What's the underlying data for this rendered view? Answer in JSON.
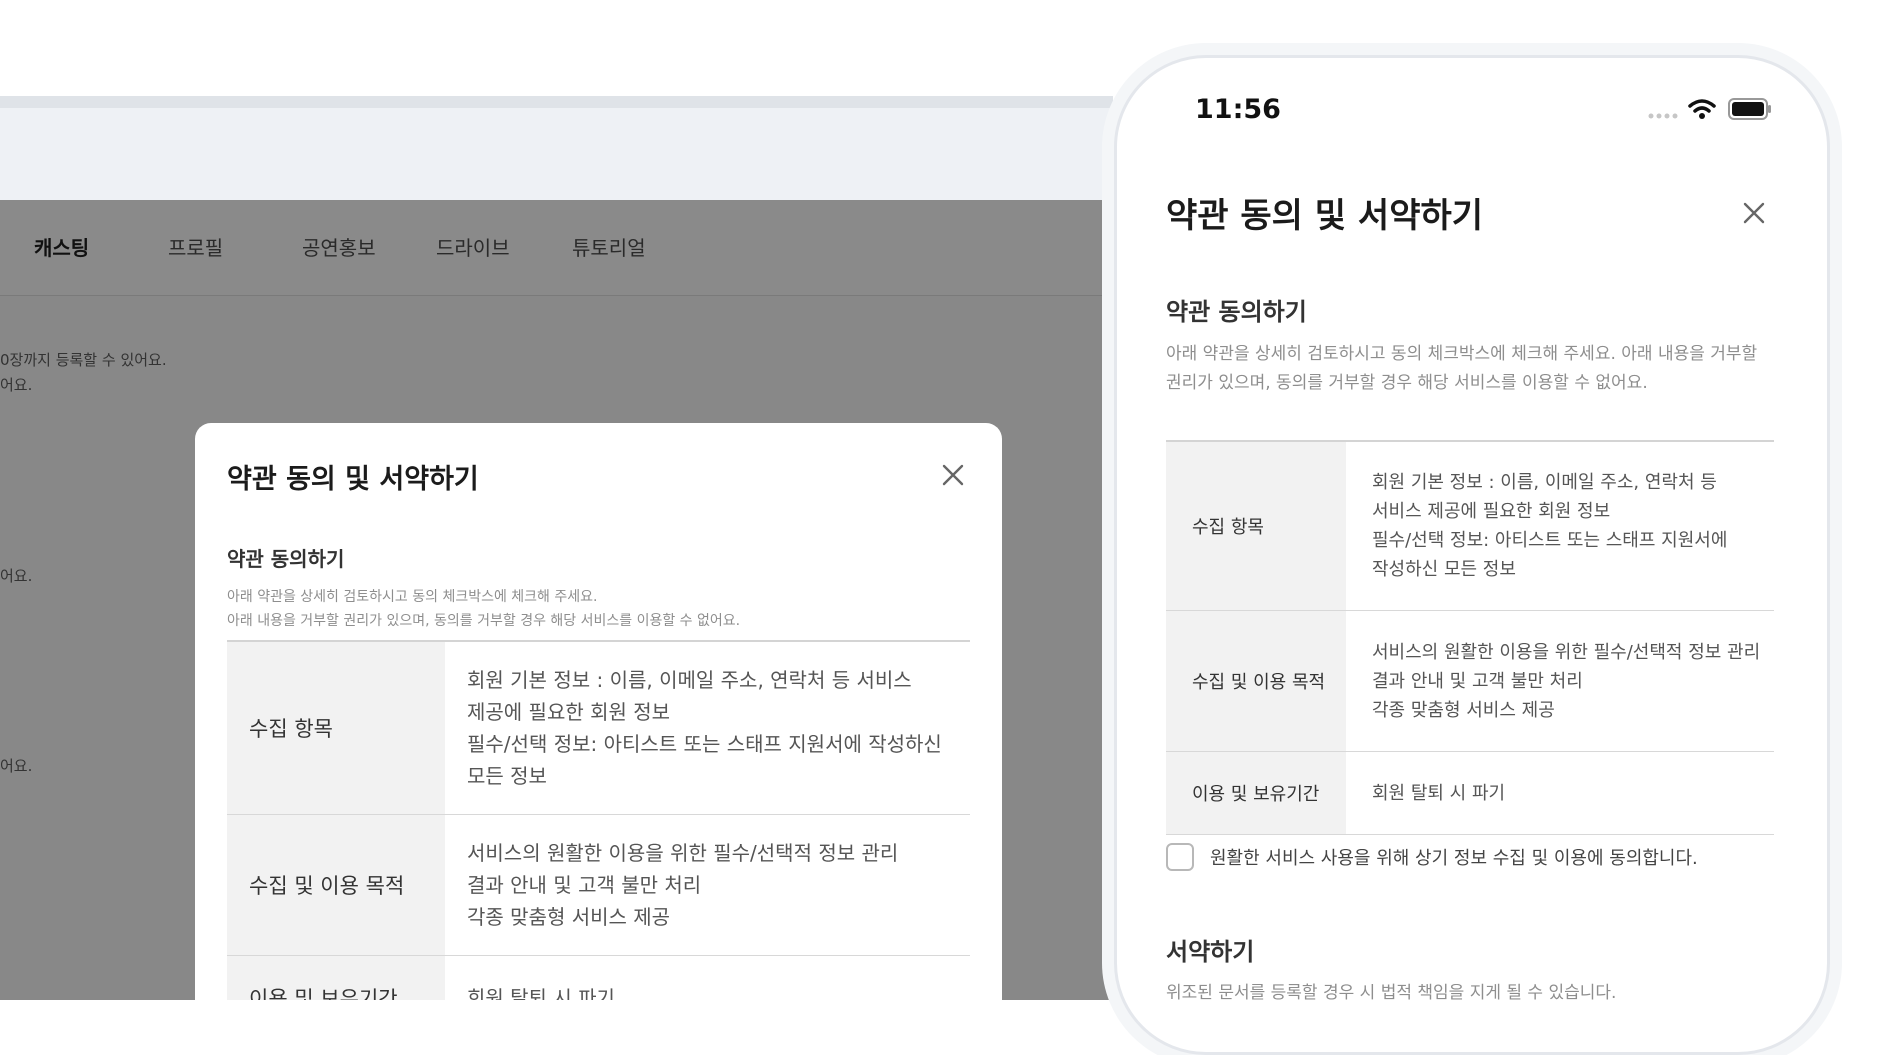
{
  "desktop": {
    "nav": [
      "캐스팅",
      "프로필",
      "공연홍보",
      "드라이브",
      "튜토리얼"
    ],
    "bg_texts": [
      "0장까지 등록할 수 있어요.",
      "어요.",
      "어요.",
      "어요."
    ],
    "modal": {
      "title": "약관 동의 및 서약하기",
      "section_title": "약관 동의하기",
      "desc_1": "아래 약관을 상세히 검토하시고 동의 체크박스에 체크해 주세요.",
      "desc_2": "아래 내용을 거부할 권리가 있으며, 동의를 거부할 경우 해당 서비스를 이용할 수 없어요.",
      "rows": [
        {
          "label": "수집 항목",
          "lines": [
            "회원 기본 정보 : 이름, 이메일 주소, 연락처 등 서비스",
            "제공에 필요한 회원 정보",
            "필수/선택 정보: 아티스트 또는 스태프 지원서에 작성하신",
            "모든 정보"
          ]
        },
        {
          "label": "수집 및 이용 목적",
          "lines": [
            "서비스의 원활한 이용을 위한 필수/선택적 정보 관리",
            "결과 안내 및 고객 불만 처리",
            "각종 맞춤형 서비스 제공"
          ]
        },
        {
          "label": "이용 및 보유기간",
          "lines": [
            "회원 탈퇴 시 파기"
          ]
        }
      ]
    }
  },
  "phone": {
    "status_time": "11:56",
    "title": "약관 동의 및 서약하기",
    "section_title": "약관 동의하기",
    "desc": "아래 약관을 상세히 검토하시고 동의 체크박스에 체크해 주세요. 아래 내용을 거부할 권리가 있으며, 동의를 거부할 경우 해당 서비스를 이용할 수 없어요.",
    "rows": [
      {
        "label": "수집 항목",
        "lines": [
          "회원 기본 정보 : 이름, 이메일 주소, 연락처 등",
          "서비스 제공에 필요한 회원 정보",
          "필수/선택 정보: 아티스트 또는 스태프 지원서에",
          "작성하신 모든 정보"
        ]
      },
      {
        "label": "수집 및 이용 목적",
        "lines": [
          "서비스의 원활한 이용을 위한 필수/선택적 정보 관리",
          "결과 안내 및 고객 불만 처리",
          "각종 맞춤형 서비스 제공"
        ]
      },
      {
        "label": "이용 및 보유기간",
        "lines": [
          "회원 탈퇴 시 파기"
        ]
      }
    ],
    "agree_label": "원활한 서비스 사용을 위해 상기 정보 수집 및 이용에 동의합니다.",
    "sign_title": "서약하기",
    "sign_desc": "위조된 문서를 등록할 경우 시 법적 책임을 지게 될 수 있습니다."
  },
  "colors": {
    "overlay": "#888888",
    "table_label_bg": "#f2f2f2",
    "muted_text": "#8e8e8e"
  },
  "icons": [
    "close-icon",
    "signal-icon",
    "wifi-icon",
    "battery-icon"
  ]
}
